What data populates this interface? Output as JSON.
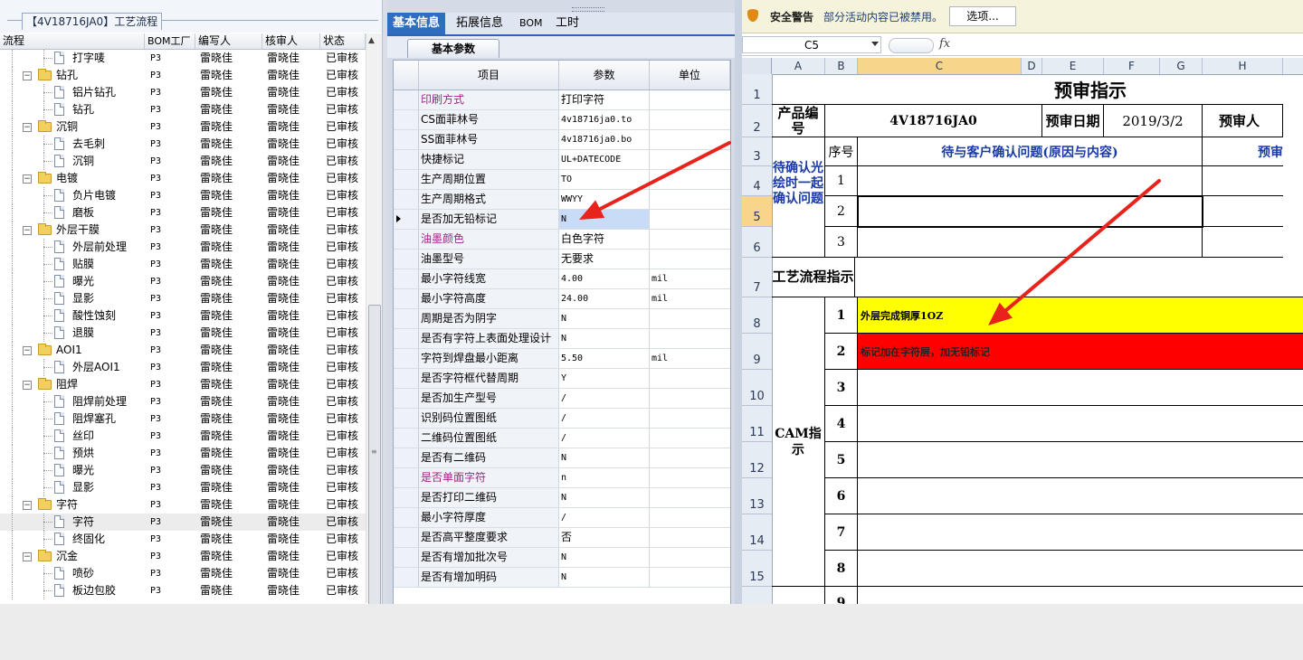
{
  "left_panel": {
    "title": "【4V18716JA0】工艺流程",
    "columns": [
      "流程",
      "BOM工厂",
      "编写人",
      "核审人",
      "状态"
    ],
    "rows": [
      {
        "level": 1,
        "kind": "leaf",
        "name": "打字唛",
        "bom": "P3",
        "writer": "雷晓佳",
        "reviewer": "雷晓佳",
        "status": "已审核"
      },
      {
        "level": 0,
        "kind": "group",
        "name": "钻孔",
        "bom": "P3",
        "writer": "雷晓佳",
        "reviewer": "雷晓佳",
        "status": "已审核"
      },
      {
        "level": 1,
        "kind": "leaf",
        "name": "铝片钻孔",
        "bom": "P3",
        "writer": "雷晓佳",
        "reviewer": "雷晓佳",
        "status": "已审核"
      },
      {
        "level": 1,
        "kind": "leaf",
        "name": "钻孔",
        "bom": "P3",
        "writer": "雷晓佳",
        "reviewer": "雷晓佳",
        "status": "已审核"
      },
      {
        "level": 0,
        "kind": "group",
        "name": "沉铜",
        "bom": "P3",
        "writer": "雷晓佳",
        "reviewer": "雷晓佳",
        "status": "已审核"
      },
      {
        "level": 1,
        "kind": "leaf",
        "name": "去毛刺",
        "bom": "P3",
        "writer": "雷晓佳",
        "reviewer": "雷晓佳",
        "status": "已审核"
      },
      {
        "level": 1,
        "kind": "leaf",
        "name": "沉铜",
        "bom": "P3",
        "writer": "雷晓佳",
        "reviewer": "雷晓佳",
        "status": "已审核"
      },
      {
        "level": 0,
        "kind": "group",
        "name": "电镀",
        "bom": "P3",
        "writer": "雷晓佳",
        "reviewer": "雷晓佳",
        "status": "已审核"
      },
      {
        "level": 1,
        "kind": "leaf",
        "name": "负片电镀",
        "bom": "P3",
        "writer": "雷晓佳",
        "reviewer": "雷晓佳",
        "status": "已审核"
      },
      {
        "level": 1,
        "kind": "leaf",
        "name": "磨板",
        "bom": "P3",
        "writer": "雷晓佳",
        "reviewer": "雷晓佳",
        "status": "已审核"
      },
      {
        "level": 0,
        "kind": "group",
        "name": "外层干膜",
        "bom": "P3",
        "writer": "雷晓佳",
        "reviewer": "雷晓佳",
        "status": "已审核"
      },
      {
        "level": 1,
        "kind": "leaf",
        "name": "外层前处理",
        "bom": "P3",
        "writer": "雷晓佳",
        "reviewer": "雷晓佳",
        "status": "已审核"
      },
      {
        "level": 1,
        "kind": "leaf",
        "name": "贴膜",
        "bom": "P3",
        "writer": "雷晓佳",
        "reviewer": "雷晓佳",
        "status": "已审核"
      },
      {
        "level": 1,
        "kind": "leaf",
        "name": "曝光",
        "bom": "P3",
        "writer": "雷晓佳",
        "reviewer": "雷晓佳",
        "status": "已审核"
      },
      {
        "level": 1,
        "kind": "leaf",
        "name": "显影",
        "bom": "P3",
        "writer": "雷晓佳",
        "reviewer": "雷晓佳",
        "status": "已审核"
      },
      {
        "level": 1,
        "kind": "leaf",
        "name": "酸性蚀刻",
        "bom": "P3",
        "writer": "雷晓佳",
        "reviewer": "雷晓佳",
        "status": "已审核"
      },
      {
        "level": 1,
        "kind": "leaf",
        "name": "退膜",
        "bom": "P3",
        "writer": "雷晓佳",
        "reviewer": "雷晓佳",
        "status": "已审核"
      },
      {
        "level": 0,
        "kind": "group",
        "name": "AOI1",
        "bom": "P3",
        "writer": "雷晓佳",
        "reviewer": "雷晓佳",
        "status": "已审核"
      },
      {
        "level": 1,
        "kind": "leaf",
        "name": "外层AOI1",
        "bom": "P3",
        "writer": "雷晓佳",
        "reviewer": "雷晓佳",
        "status": "已审核"
      },
      {
        "level": 0,
        "kind": "group",
        "name": "阻焊",
        "bom": "P3",
        "writer": "雷晓佳",
        "reviewer": "雷晓佳",
        "status": "已审核"
      },
      {
        "level": 1,
        "kind": "leaf",
        "name": "阻焊前处理",
        "bom": "P3",
        "writer": "雷晓佳",
        "reviewer": "雷晓佳",
        "status": "已审核"
      },
      {
        "level": 1,
        "kind": "leaf",
        "name": "阻焊塞孔",
        "bom": "P3",
        "writer": "雷晓佳",
        "reviewer": "雷晓佳",
        "status": "已审核"
      },
      {
        "level": 1,
        "kind": "leaf",
        "name": "丝印",
        "bom": "P3",
        "writer": "雷晓佳",
        "reviewer": "雷晓佳",
        "status": "已审核"
      },
      {
        "level": 1,
        "kind": "leaf",
        "name": "预烘",
        "bom": "P3",
        "writer": "雷晓佳",
        "reviewer": "雷晓佳",
        "status": "已审核"
      },
      {
        "level": 1,
        "kind": "leaf",
        "name": "曝光",
        "bom": "P3",
        "writer": "雷晓佳",
        "reviewer": "雷晓佳",
        "status": "已审核"
      },
      {
        "level": 1,
        "kind": "leaf",
        "name": "显影",
        "bom": "P3",
        "writer": "雷晓佳",
        "reviewer": "雷晓佳",
        "status": "已审核"
      },
      {
        "level": 0,
        "kind": "group",
        "name": "字符",
        "bom": "P3",
        "writer": "雷晓佳",
        "reviewer": "雷晓佳",
        "status": "已审核"
      },
      {
        "level": 1,
        "kind": "leaf",
        "name": "字符",
        "bom": "P3",
        "writer": "雷晓佳",
        "reviewer": "雷晓佳",
        "status": "已审核",
        "selected": true
      },
      {
        "level": 1,
        "kind": "leaf",
        "name": "终固化",
        "bom": "P3",
        "writer": "雷晓佳",
        "reviewer": "雷晓佳",
        "status": "已审核"
      },
      {
        "level": 0,
        "kind": "group",
        "name": "沉金",
        "bom": "P3",
        "writer": "雷晓佳",
        "reviewer": "雷晓佳",
        "status": "已审核"
      },
      {
        "level": 1,
        "kind": "leaf",
        "name": "喷砂",
        "bom": "P3",
        "writer": "雷晓佳",
        "reviewer": "雷晓佳",
        "status": "已审核"
      },
      {
        "level": 1,
        "kind": "leaf",
        "name": "板边包胶",
        "bom": "P3",
        "writer": "雷晓佳",
        "reviewer": "雷晓佳",
        "status": "已审核"
      }
    ]
  },
  "mid_panel": {
    "tabs": [
      "基本信息",
      "拓展信息",
      "BOM",
      "工时"
    ],
    "active_tab": 0,
    "subtab": "基本参数",
    "columns": [
      "项目",
      "参数",
      "单位"
    ],
    "rows": [
      {
        "item": "印刷方式",
        "value": "打印字符",
        "unit": "",
        "hl": true
      },
      {
        "item": "CS面菲林号",
        "value": "4v18716ja0.to",
        "unit": "",
        "mono": true
      },
      {
        "item": "SS面菲林号",
        "value": "4v18716ja0.bo",
        "unit": "",
        "mono": true
      },
      {
        "item": "快捷标记",
        "value": "UL+DATECODE",
        "unit": "",
        "mono": true
      },
      {
        "item": "生产周期位置",
        "value": "TO",
        "unit": "",
        "mono": true
      },
      {
        "item": "生产周期格式",
        "value": "WWYY",
        "unit": "",
        "mono": true
      },
      {
        "item": "是否加无铅标记",
        "value": "N",
        "unit": "",
        "mono": true,
        "current": true
      },
      {
        "item": "油墨颜色",
        "value": "白色字符",
        "unit": "",
        "hl": true
      },
      {
        "item": "油墨型号",
        "value": "无要求",
        "unit": ""
      },
      {
        "item": "最小字符线宽",
        "value": "4.00",
        "unit": "mil",
        "mono": true
      },
      {
        "item": "最小字符高度",
        "value": "24.00",
        "unit": "mil",
        "mono": true
      },
      {
        "item": "周期是否为阴字",
        "value": "N",
        "unit": "",
        "mono": true
      },
      {
        "item": "是否有字符上表面处理设计",
        "value": "N",
        "unit": "",
        "mono": true
      },
      {
        "item": "字符到焊盘最小距离",
        "value": "5.50",
        "unit": "mil",
        "mono": true
      },
      {
        "item": "是否字符框代替周期",
        "value": "Y",
        "unit": "",
        "mono": true
      },
      {
        "item": "是否加生产型号",
        "value": "/",
        "unit": "",
        "mono": true
      },
      {
        "item": "识别码位置图纸",
        "value": "/",
        "unit": "",
        "mono": true
      },
      {
        "item": "二维码位置图纸",
        "value": "/",
        "unit": "",
        "mono": true
      },
      {
        "item": "是否有二维码",
        "value": "N",
        "unit": "",
        "mono": true
      },
      {
        "item": "是否单面字符",
        "value": "n",
        "unit": "",
        "mono": true,
        "hl": true
      },
      {
        "item": "是否打印二维码",
        "value": "N",
        "unit": "",
        "mono": true
      },
      {
        "item": "最小字符厚度",
        "value": "/",
        "unit": "",
        "mono": true
      },
      {
        "item": "是否高平整度要求",
        "value": "否",
        "unit": ""
      },
      {
        "item": "是否有增加批次号",
        "value": "N",
        "unit": "",
        "mono": true
      },
      {
        "item": "是否有增加明码",
        "value": "N",
        "unit": "",
        "mono": true
      }
    ]
  },
  "sheet": {
    "security_title": "安全警告",
    "security_message": "部分活动内容已被禁用。",
    "options_label": "选项...",
    "name_box": "C5",
    "fx_label": "fx",
    "columns": [
      "A",
      "B",
      "C",
      "D",
      "E",
      "F",
      "G",
      "H"
    ],
    "row_numbers": [
      "1",
      "2",
      "3",
      "4",
      "5",
      "6",
      "7",
      "8",
      "9",
      "10",
      "11",
      "12",
      "13",
      "14",
      "15"
    ],
    "title": "预审指示",
    "product_code_label": "产品编号",
    "product_code": "4V18716JA0",
    "review_date_label": "预审日期",
    "review_date": "2019/3/2",
    "reviewer_label": "预审人",
    "seq_label": "序号",
    "question_header": "待与客户确认问题(原因与内容)",
    "pre_header": "预审",
    "confirm_label": "待确认光绘时一起确认问题",
    "process_label": "工艺流程指示",
    "cam_label": "CAM指示",
    "question_seq": [
      "1",
      "2",
      "3"
    ],
    "cam_seq": [
      "1",
      "2",
      "3",
      "4",
      "5",
      "6",
      "7",
      "8",
      "9"
    ],
    "cam_items": [
      "外层完成铜厚1OZ",
      "标记加在字符层，加无铅标记"
    ],
    "colors": {
      "yellow": "#ffff00",
      "red": "#ff0000",
      "arrow": "#e8231c"
    }
  }
}
